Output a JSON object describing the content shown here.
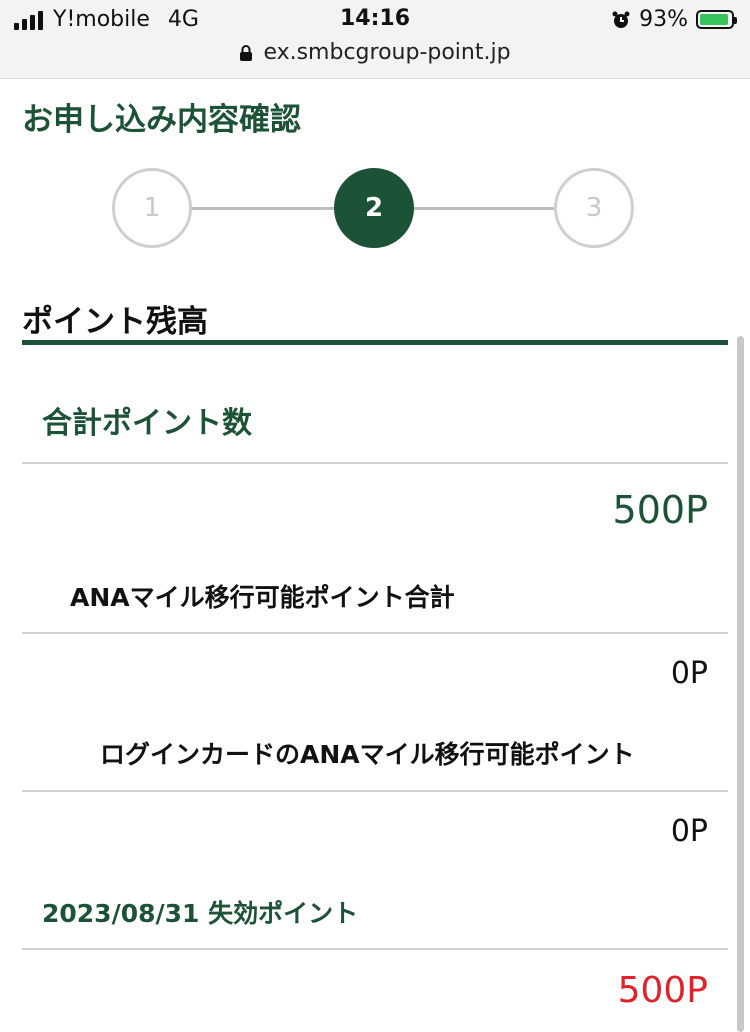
{
  "status_bar": {
    "carrier": "Y!mobile",
    "network": "4G",
    "time": "14:16",
    "battery_percent": "93%",
    "battery_level": 0.93,
    "url": "ex.smbcgroup-point.jp"
  },
  "page": {
    "title": "お申し込み内容確認"
  },
  "stepper": {
    "steps": [
      "1",
      "2",
      "3"
    ],
    "current_step": 2
  },
  "section": {
    "title": "ポイント残高"
  },
  "rows": [
    {
      "label": "合計ポイント数",
      "value": "500P"
    },
    {
      "label": "ANAマイル移行可能ポイント合計",
      "value": "0P"
    },
    {
      "label": "ログインカードのANAマイル移行可能ポイント",
      "value": "0P"
    },
    {
      "label": "2023/08/31 失効ポイント",
      "value": "500P"
    }
  ],
  "colors": {
    "brand_green": "#1c5236",
    "expiry_red": "#e0232b",
    "inactive_gray": "#c8c8c8"
  }
}
